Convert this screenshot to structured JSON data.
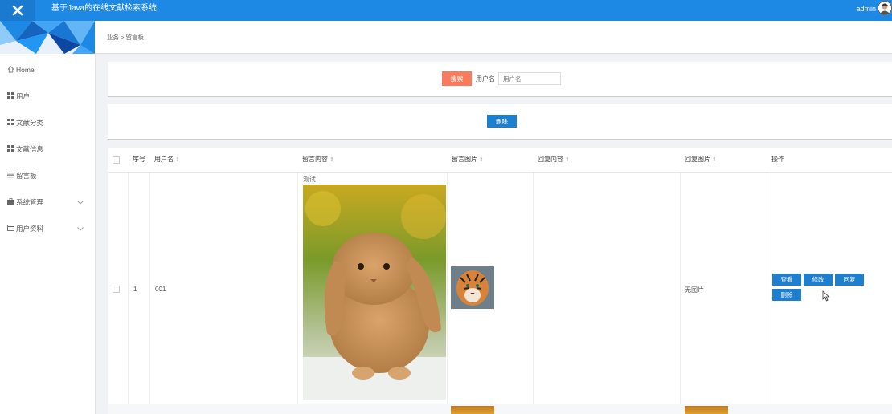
{
  "header": {
    "app_title": "基于Java的在线文献检索系统",
    "user": "admin",
    "brand_color": "#1e88e5"
  },
  "sidebar": {
    "items": [
      {
        "label": "Home",
        "icon": "home-icon"
      },
      {
        "label": "用户",
        "icon": "grid-icon"
      },
      {
        "label": "文献分类",
        "icon": "grid-icon"
      },
      {
        "label": "文献信息",
        "icon": "grid-icon"
      },
      {
        "label": "留言板",
        "icon": "list-icon"
      },
      {
        "label": "系统管理",
        "icon": "briefcase-icon",
        "expandable": true
      },
      {
        "label": "用户资料",
        "icon": "card-icon",
        "expandable": true
      }
    ]
  },
  "breadcrumb": "业务 > 留言板",
  "search": {
    "button_label": "搜索",
    "field_label": "用户名",
    "placeholder": "用户名"
  },
  "actions": {
    "delete_label": "删除"
  },
  "table": {
    "columns": [
      "序号",
      "用户名",
      "留言内容",
      "留言图片",
      "回复内容",
      "回复图片",
      "操作"
    ],
    "rows": [
      {
        "index": "1",
        "username": "001",
        "content": "测试",
        "content_image": "rabbit-photo",
        "message_image": "tiger-photo",
        "reply_content": "",
        "reply_image": "无图片",
        "operations": [
          "查看",
          "修改",
          "回复",
          "删除"
        ]
      }
    ]
  },
  "colors": {
    "search_button": "#fa7a5c",
    "action_button": "#1e7fcf"
  }
}
